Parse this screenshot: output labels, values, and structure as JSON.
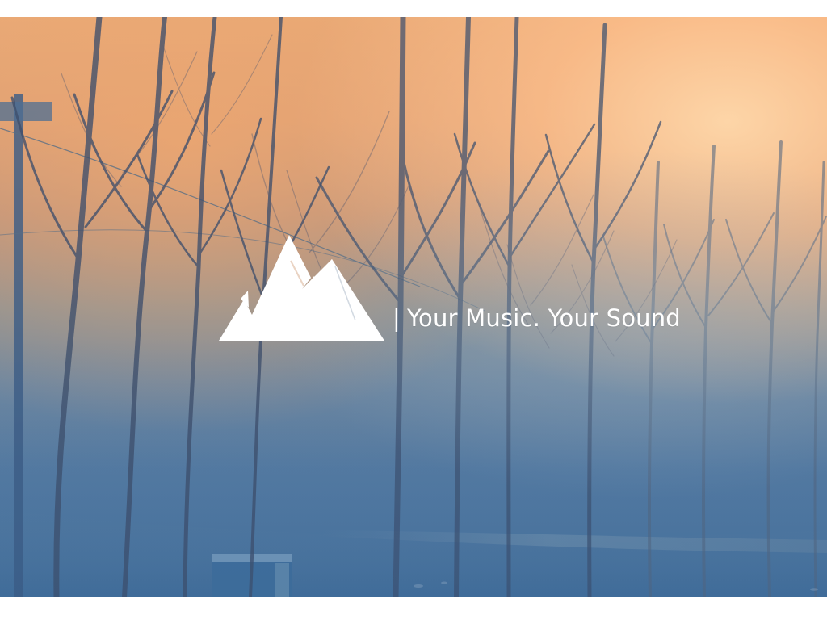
{
  "brand": {
    "logo_icon": "mountain-logo-icon",
    "separator": "|",
    "tagline": "Your Music. Your Sound"
  },
  "colors": {
    "background_top": "#e7a977",
    "background_bottom": "#47739e",
    "text": "#ffffff"
  }
}
